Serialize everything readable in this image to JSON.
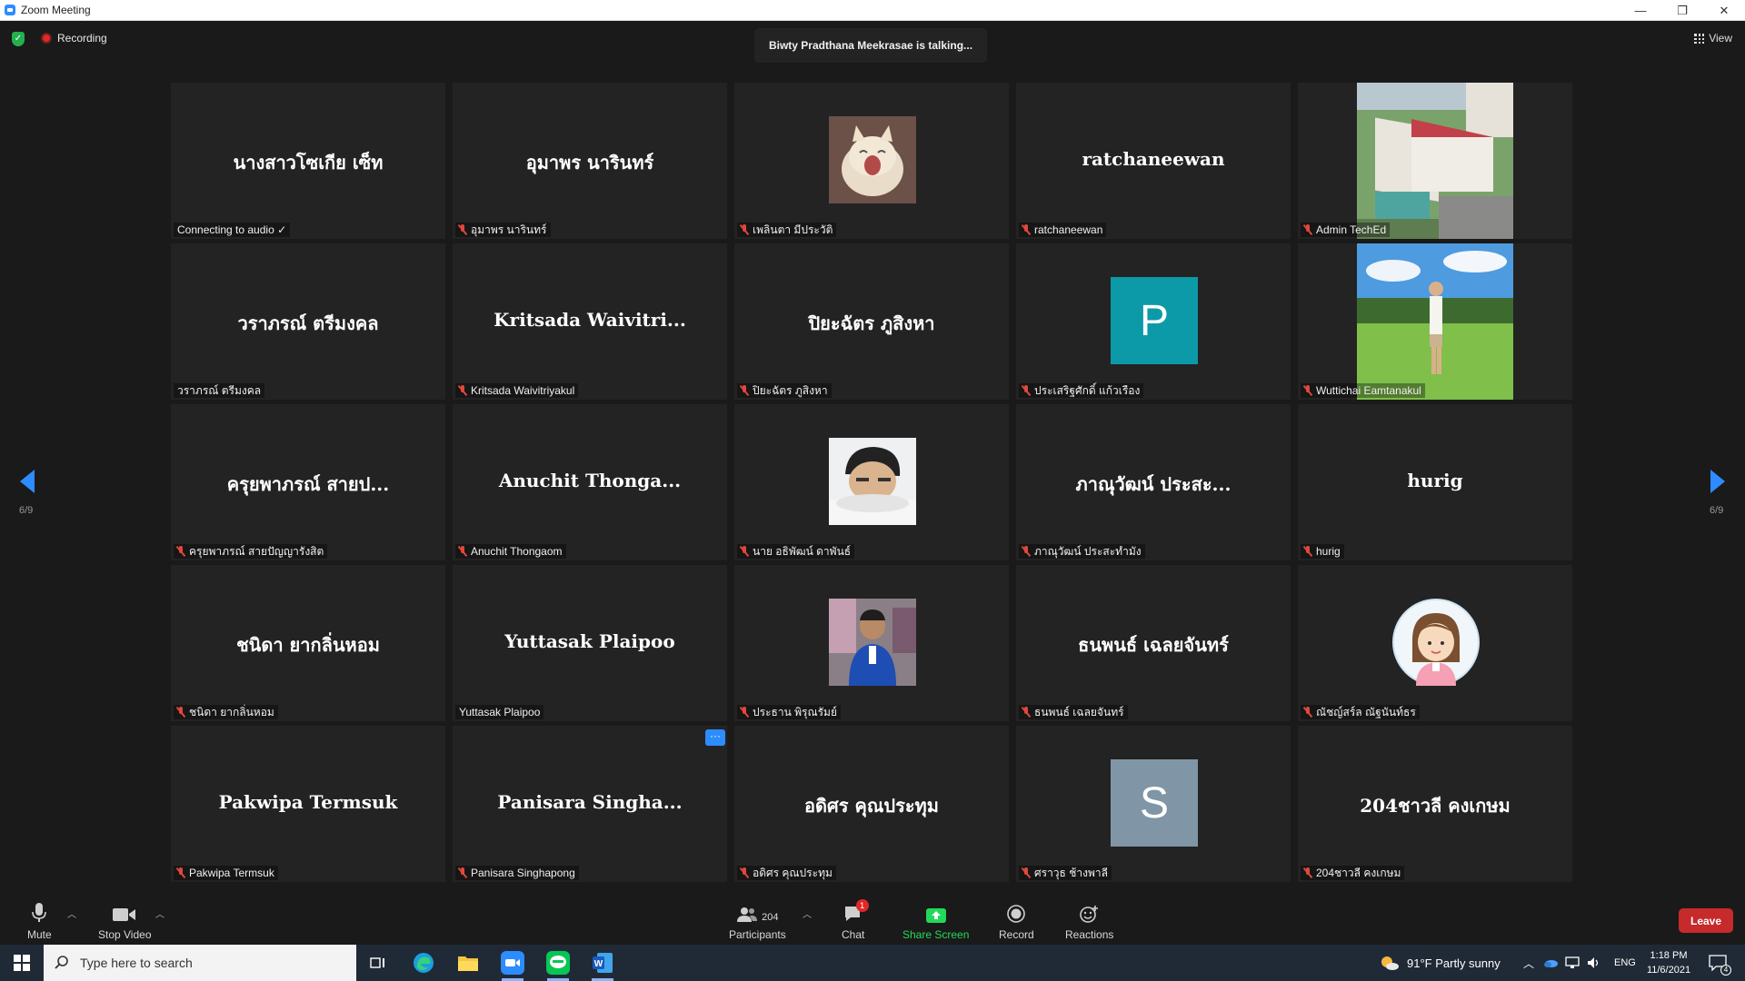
{
  "window": {
    "title": "Zoom Meeting",
    "controls": [
      "—",
      "❐",
      "✕"
    ]
  },
  "meeting": {
    "recording_label": "Recording",
    "talking": "Biwty Pradthana Meekrasae is talking...",
    "view_label": "View",
    "page_indicator_left": "6/9",
    "page_indicator_right": "6/9"
  },
  "tiles": [
    {
      "display": "นางสาวโซเกีย เซ็ท",
      "label": "Connecting to audio ✓",
      "muted": false,
      "kind": "name"
    },
    {
      "display": "อุมาพร นารินทร์",
      "label": "อุมาพร นารินทร์",
      "muted": true,
      "kind": "name"
    },
    {
      "display": "",
      "label": "เพลินตา มีประวัติ",
      "muted": true,
      "kind": "photo",
      "photo": "cat-photo"
    },
    {
      "display": "ratchaneewan",
      "label": "ratchaneewan",
      "muted": true,
      "kind": "name"
    },
    {
      "display": "",
      "label": "Admin TechEd",
      "muted": true,
      "kind": "bigphoto",
      "photo": "building-photo"
    },
    {
      "display": "วราภรณ์ ตรีมงคล",
      "label": "วราภรณ์ ตรีมงคล",
      "muted": false,
      "kind": "name"
    },
    {
      "display": "Kritsada Waivitri...",
      "label": "Kritsada Waivitriyakul",
      "muted": true,
      "kind": "name"
    },
    {
      "display": "ปิยะฉัตร ภูสิงหา",
      "label": "ปิยะฉัตร ภูสิงหา",
      "muted": true,
      "kind": "name"
    },
    {
      "display": "P",
      "label": "ประเสริฐศักดิ์ แก้วเรือง",
      "muted": true,
      "kind": "letter",
      "color": "#0d9aa8"
    },
    {
      "display": "",
      "label": "Wuttichai Eamtanakul",
      "muted": true,
      "kind": "bigphoto",
      "photo": "field-photo"
    },
    {
      "display": "ครุยพาภรณ์ สายป...",
      "label": "ครุยพาภรณ์ สายปัญญารังสิต",
      "muted": true,
      "kind": "name"
    },
    {
      "display": "Anuchit Thonga...",
      "label": "Anuchit Thongaom",
      "muted": true,
      "kind": "name"
    },
    {
      "display": "",
      "label": "นาย อธิพัฒน์ ดาพันธ์",
      "muted": true,
      "kind": "photo",
      "photo": "boy-photo"
    },
    {
      "display": "ภาณุวัฒน์ ประสะ...",
      "label": "ภาณุวัฒน์ ประสะทำมัง",
      "muted": true,
      "kind": "name"
    },
    {
      "display": "hurig",
      "label": "hurig",
      "muted": true,
      "kind": "name"
    },
    {
      "display": "ชนิดา ยากลิ่นหอม",
      "label": "ชนิดา ยากลิ่นหอม",
      "muted": true,
      "kind": "name"
    },
    {
      "display": "Yuttasak Plaipoo",
      "label": "Yuttasak Plaipoo",
      "muted": false,
      "kind": "name"
    },
    {
      "display": "",
      "label": "ประธาน พิรุณรัมย์",
      "muted": true,
      "kind": "photo",
      "photo": "student-photo"
    },
    {
      "display": "ธนพนธ์ เฉลยจันทร์",
      "label": "ธนพนธ์ เฉลยจันทร์",
      "muted": true,
      "kind": "name"
    },
    {
      "display": "",
      "label": "ณัชญ์สร์ล ณัฐนันท์ธร",
      "muted": true,
      "kind": "cartoon",
      "photo": "cartoon-avatar"
    },
    {
      "display": "Pakwipa Termsuk",
      "label": "Pakwipa Termsuk",
      "muted": true,
      "kind": "name"
    },
    {
      "display": "Panisara Singha...",
      "label": "Panisara Singhapong",
      "muted": true,
      "kind": "name",
      "more": "···"
    },
    {
      "display": "อดิศร คุณประทุม",
      "label": "อดิศร คุณประทุม",
      "muted": true,
      "kind": "name"
    },
    {
      "display": "S",
      "label": "ศราวุธ ช้างพาลี",
      "muted": true,
      "kind": "letter",
      "color": "#8096a6"
    },
    {
      "display": "204ชาวลี คงเกษม",
      "label": "204ชาวลี คงเกษม",
      "muted": true,
      "kind": "name"
    }
  ],
  "toolbar": {
    "mute": "Mute",
    "stop_video": "Stop Video",
    "participants": "Participants",
    "participants_count": "204",
    "chat": "Chat",
    "chat_badge": "1",
    "share_screen": "Share Screen",
    "record": "Record",
    "reactions": "Reactions",
    "leave": "Leave"
  },
  "taskbar": {
    "search_placeholder": "Type here to search",
    "weather": "91°F  Partly sunny",
    "lang": "ENG",
    "time": "1:18 PM",
    "date": "11/6/2021",
    "notif_count": "4"
  },
  "colors": {
    "share_green": "#23d959",
    "accent_blue": "#2d8cff",
    "leave_red": "#c62a2a"
  }
}
